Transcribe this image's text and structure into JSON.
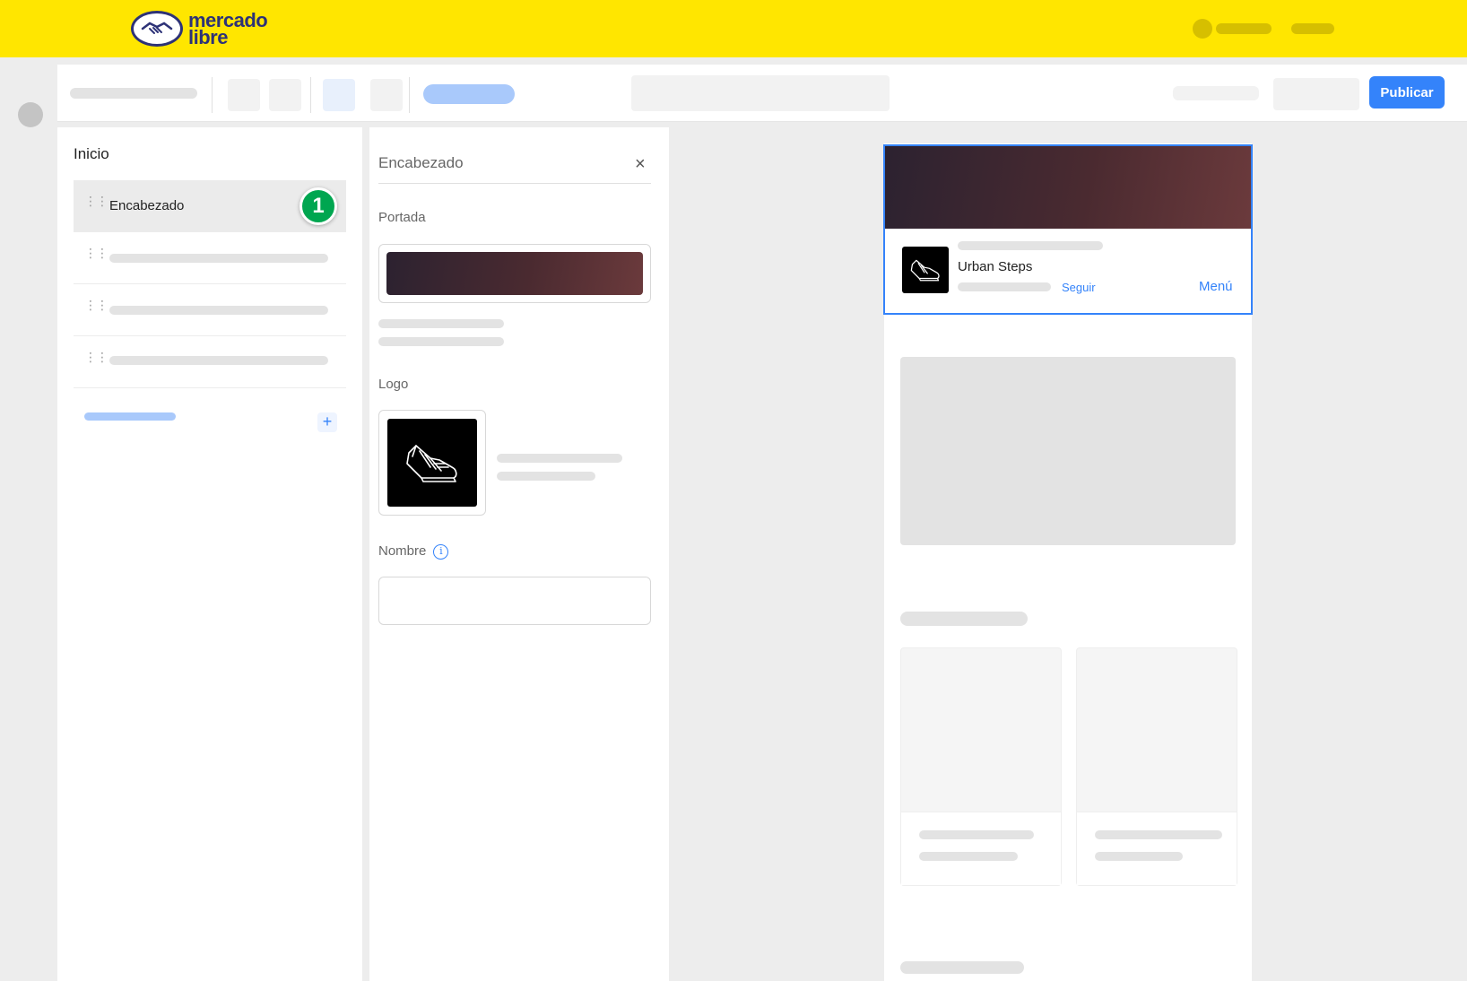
{
  "brand": {
    "name_line1": "mercado",
    "name_line2": "libre",
    "colors": {
      "yellow": "#ffe600",
      "navy": "#2d3277",
      "accent_blue": "#3483fa",
      "badge_green": "#00a650"
    }
  },
  "toolbar": {
    "publish_label": "Publicar"
  },
  "sections_panel": {
    "title": "Inicio",
    "items": [
      {
        "label": "Encabezado",
        "active": true,
        "badge": "1"
      }
    ],
    "add_icon": "+"
  },
  "editor": {
    "title": "Encabezado",
    "close_icon": "×",
    "cover_label": "Portada",
    "logo_label": "Logo",
    "name_label": "Nombre",
    "info_icon": "i",
    "name_value": ""
  },
  "preview": {
    "store_name": "Urban Steps",
    "follow_label": "Seguir",
    "menu_label": "Menú"
  },
  "icons": [
    "handshake-logo-icon",
    "grip-icon",
    "close-icon",
    "info-icon",
    "plus-icon",
    "sneaker-icon"
  ]
}
